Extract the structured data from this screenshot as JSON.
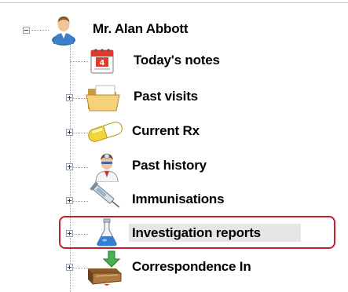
{
  "root": {
    "label": "Mr. Alan Abbott",
    "expander_state": "-",
    "icon": "patient-icon"
  },
  "items": [
    {
      "label": "Today's notes",
      "icon": "calendar-icon",
      "expandable": false
    },
    {
      "label": "Past visits",
      "icon": "folder-icon",
      "expandable": true
    },
    {
      "label": "Current Rx",
      "icon": "pill-icon",
      "expandable": true
    },
    {
      "label": "Past history",
      "icon": "doctor-icon",
      "expandable": true
    },
    {
      "label": "Immunisations",
      "icon": "syringe-icon",
      "expandable": true
    },
    {
      "label": "Investigation reports",
      "icon": "flask-icon",
      "expandable": true,
      "highlighted": true
    },
    {
      "label": "Correspondence In",
      "icon": "inbox-icon",
      "expandable": true
    }
  ],
  "colors": {
    "highlight_border": "#c0202a",
    "selection_bg": "#e6e6e6",
    "connector": "#9a9a9a"
  }
}
